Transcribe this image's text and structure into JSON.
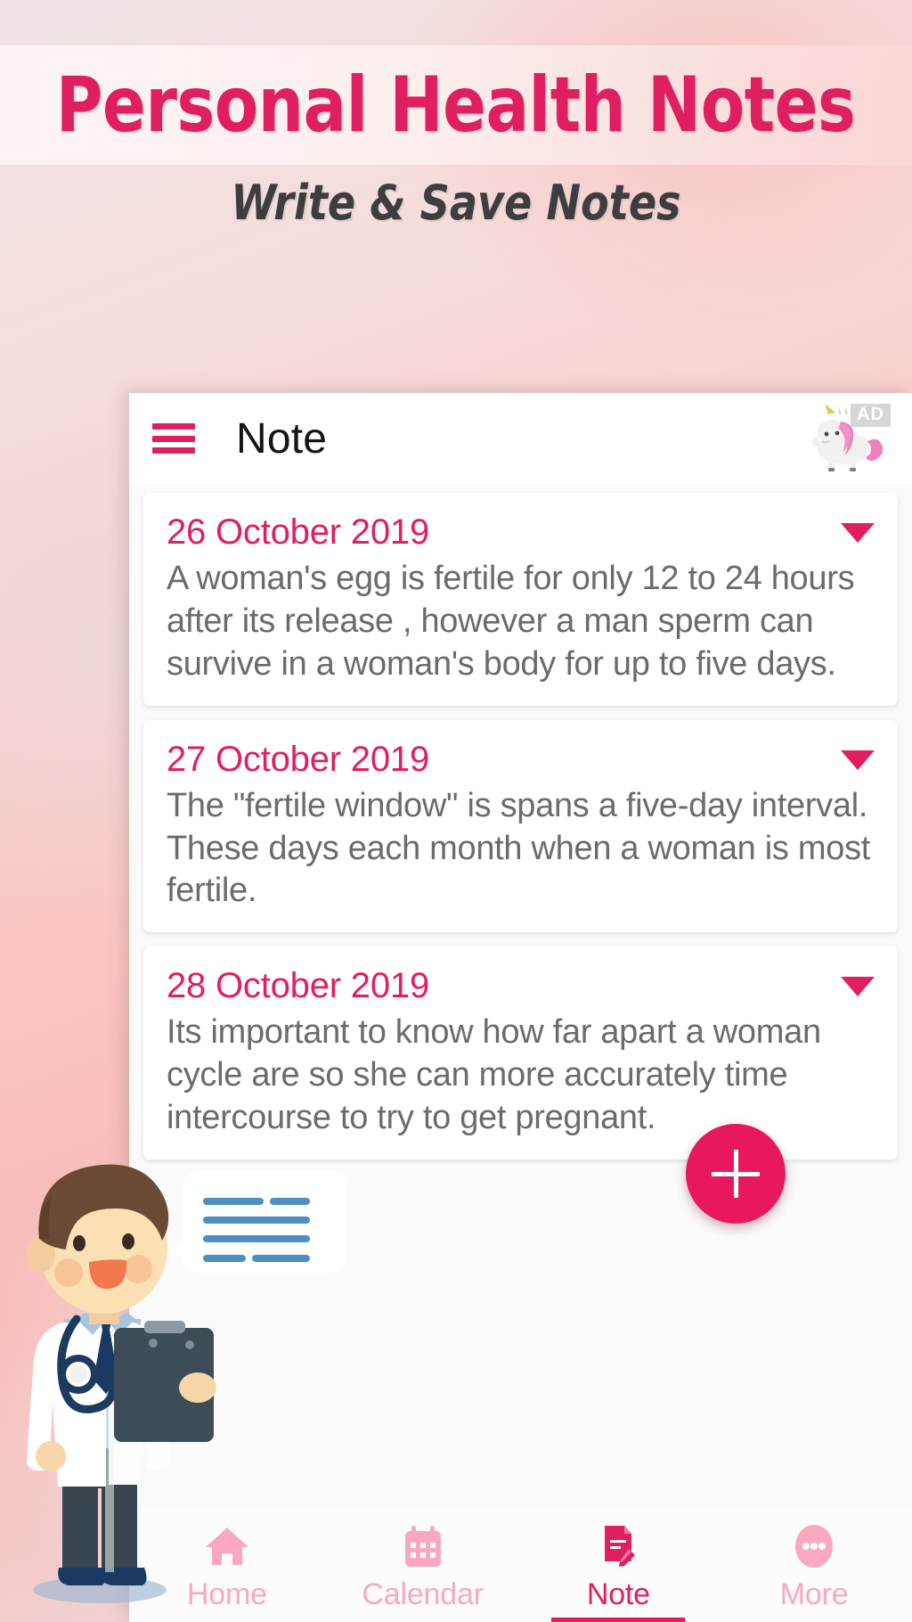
{
  "promo": {
    "title": "Personal Health Notes",
    "subtitle": "Write & Save Notes",
    "title_color": "#e01f60",
    "subtitle_color": "#3e3e3e"
  },
  "app": {
    "accent_color": "#e01f60",
    "accent_light": "#f9a8c0",
    "header": {
      "menu_icon": "hamburger-menu-icon",
      "title": "Note",
      "ad_icon": "unicorn-icon",
      "ad_badge": "AD"
    },
    "notes": [
      {
        "date": "26 October 2019",
        "text": "A woman's egg is fertile for only 12 to 24 hours after its release , however a man sperm can survive in a woman's body for up to five days.",
        "expand_icon": "chevron-down-icon"
      },
      {
        "date": "27 October 2019",
        "text": "The \"fertile window\" is spans a five-day interval. These days each month when a woman is most fertile.",
        "expand_icon": "chevron-down-icon"
      },
      {
        "date": "28 October 2019",
        "text": "Its important to know how far apart a woman cycle are so she can more accurately time intercourse to try to get pregnant.",
        "expand_icon": "chevron-down-icon"
      }
    ],
    "fab": {
      "label": "+",
      "icon": "plus-icon",
      "color": "#e8185f"
    },
    "bottom_nav": [
      {
        "label": "Home",
        "icon": "home-icon",
        "active": false
      },
      {
        "label": "Calendar",
        "icon": "calendar-icon",
        "active": false
      },
      {
        "label": "Note",
        "icon": "note-edit-icon",
        "active": true
      },
      {
        "label": "More",
        "icon": "more-dots-icon",
        "active": false
      }
    ]
  },
  "mascot": {
    "name": "doctor-character",
    "speech_bubble": "speech-bubble-lines"
  }
}
